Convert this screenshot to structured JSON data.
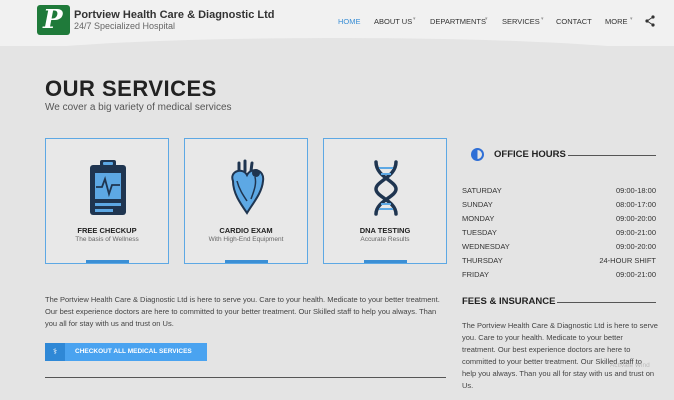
{
  "brand": {
    "logo_letter": "P",
    "name": "Portview Health Care & Diagnostic Ltd",
    "tagline": "24/7 Specialized Hospital",
    "logo_color": "#1f7a3a"
  },
  "nav": {
    "items": [
      {
        "label": "HOME",
        "active": true
      },
      {
        "label": "ABOUT US",
        "dropdown": true
      },
      {
        "label": "DEPARTMENTS",
        "dropdown": true
      },
      {
        "label": "SERVICES",
        "dropdown": true
      },
      {
        "label": "CONTACT"
      },
      {
        "label": "MORE",
        "dropdown": true
      }
    ],
    "share_icon": "share-icon",
    "active_color": "#3b8fd5"
  },
  "page": {
    "title": "OUR SERVICES",
    "subtitle": "We cover a big variety of medical services"
  },
  "services": [
    {
      "title": "FREE CHECKUP",
      "subtitle": "The basis of Wellness",
      "icon": "clipboard-heartbeat-icon"
    },
    {
      "title": "CARDIO EXAM",
      "subtitle": "With High-End Equipment",
      "icon": "heart-organ-icon"
    },
    {
      "title": "DNA TESTING",
      "subtitle": "Accurate Results",
      "icon": "dna-icon"
    }
  ],
  "intro_text": "The Portview Health Care & Diagnostic Ltd is here to serve you. Care to your health. Medicate to your better treatment. Our best experience doctors are here to committed to your better treatment. Our Skilled staff to help you always. Than you all for stay with us and trust on Us.",
  "cta": {
    "label": "CHECKOUT ALL MEDICAL SERVICES",
    "icon": "medical-services-icon",
    "color": "#4aa3f0"
  },
  "office_hours": {
    "title": "OFFICE HOURS",
    "icon": "clock-half-icon",
    "rows": [
      {
        "day": "SATURDAY",
        "time": "09:00-18:00"
      },
      {
        "day": "SUNDAY",
        "time": "08:00-17:00"
      },
      {
        "day": "MONDAY",
        "time": "09:00-20:00"
      },
      {
        "day": "TUESDAY",
        "time": "09:00-21:00"
      },
      {
        "day": "WEDNESDAY",
        "time": "09:00-20:00"
      },
      {
        "day": "THURSDAY",
        "time": "24-HOUR SHIFT"
      },
      {
        "day": "FRIDAY",
        "time": "09:00-21:00"
      }
    ]
  },
  "fees": {
    "title": "FEES & INSURANCE",
    "text": "The Portview Health Care & Diagnostic Ltd is here to serve you. Care to your health. Medicate to your better treatment. Our best experience doctors are here to committed to your better treatment. Our Skilled staff to help you always. Than you all for stay with us and trust on Us."
  },
  "watermark": "Activate Wind"
}
